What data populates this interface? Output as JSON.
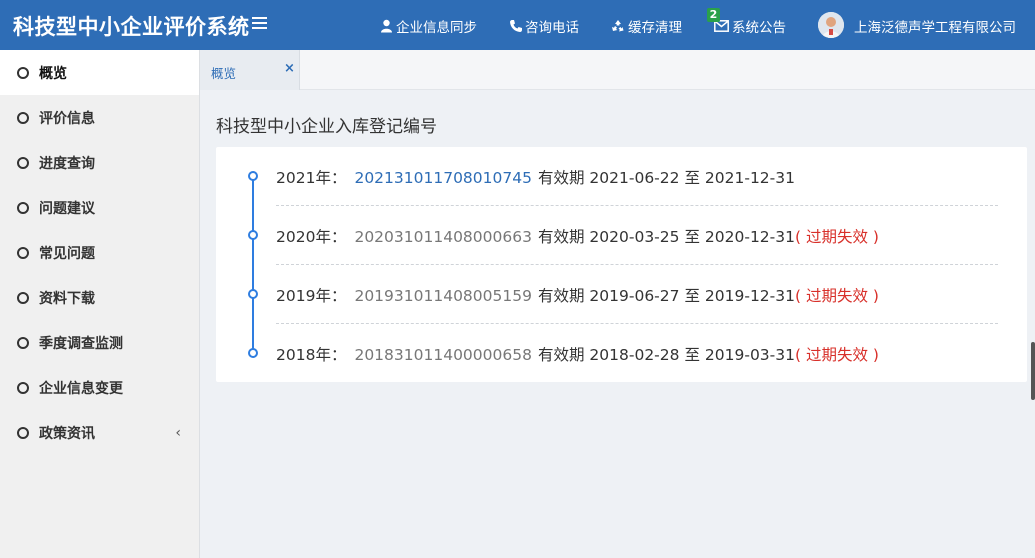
{
  "app": {
    "title": "科技型中小企业评价系统"
  },
  "topnav": {
    "sync_label": "企业信息同步",
    "phone_label": "咨询电话",
    "cache_label": "缓存清理",
    "notice_label": "系统公告",
    "notice_count": "2",
    "company_name": "上海泛德声学工程有限公司"
  },
  "sidebar": {
    "items": [
      {
        "label": "概览"
      },
      {
        "label": "评价信息"
      },
      {
        "label": "进度查询"
      },
      {
        "label": "问题建议"
      },
      {
        "label": "常见问题"
      },
      {
        "label": "资料下载"
      },
      {
        "label": "季度调查监测"
      },
      {
        "label": "企业信息变更"
      },
      {
        "label": "政策资讯"
      }
    ],
    "collapse_glyph": "‹"
  },
  "tabs": [
    {
      "label": "概览",
      "close": "×"
    }
  ],
  "section": {
    "title": "科技型中小企业入库登记编号"
  },
  "records": [
    {
      "year": "2021年：",
      "number": "202131011708010745",
      "period_label": "有效期",
      "start": "2021-06-22",
      "to": "至",
      "end": "2021-12-31",
      "status": ""
    },
    {
      "year": "2020年：",
      "number": "202031011408000663",
      "period_label": "有效期",
      "start": "2020-03-25",
      "to": "至",
      "end": "2020-12-31",
      "status": "( 过期失效 )"
    },
    {
      "year": "2019年：",
      "number": "201931011408005159",
      "period_label": "有效期",
      "start": "2019-06-27",
      "to": "至",
      "end": "2019-12-31",
      "status": "( 过期失效 )"
    },
    {
      "year": "2018年：",
      "number": "201831011400000658",
      "period_label": "有效期",
      "start": "2018-02-28",
      "to": "至",
      "end": "2019-03-31",
      "status": "( 过期失效 )"
    }
  ],
  "colors": {
    "brand": "#2e6db6",
    "link": "#2e6db6",
    "expired": "#d8302a",
    "timeline": "#2e7de0"
  }
}
